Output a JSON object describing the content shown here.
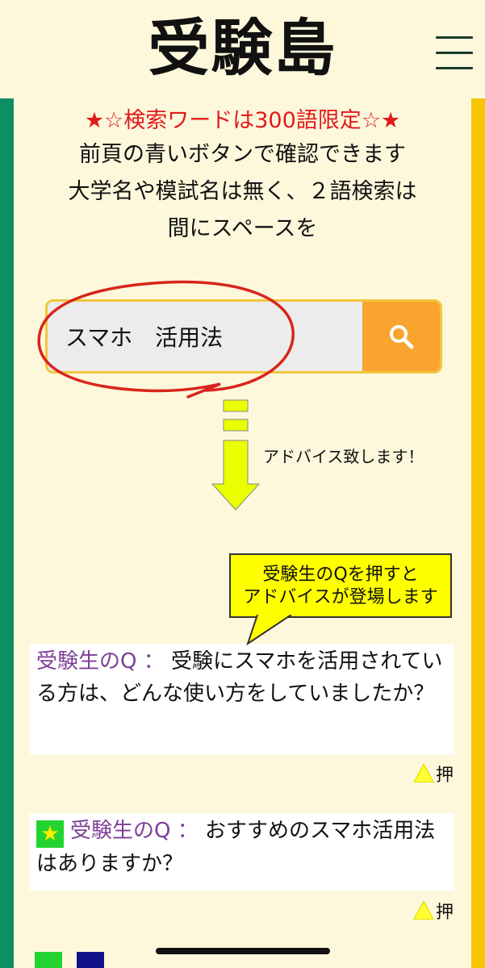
{
  "header": {
    "site_title": "受験島"
  },
  "notice": {
    "limit": "★☆検索ワードは300語限定☆★",
    "line1": "前頁の青いボタンで確認できます",
    "line2": "大学名や模試名は無く、２語検索は",
    "line3": "間にスペースを"
  },
  "search": {
    "value": "スマホ　活用法"
  },
  "advice_text": "アドバイス致します！",
  "bubble": {
    "line1": "受験生のQを押すと",
    "line2": "アドバイスが登場します"
  },
  "qa_items": [
    {
      "label": "受験生のQ ：",
      "text": " 受験にスマホを活用されている方は、どんな使い方をしていましたか？",
      "push_label": "押"
    },
    {
      "badge": "★",
      "label": "受験生のQ ：",
      "text": " おすすめのスマホ活用法はありますか？",
      "push_label": "押"
    }
  ],
  "colors": {
    "background": "#fdf8dc",
    "left_bar": "#0e8f63",
    "right_bar": "#f7c600",
    "search_button": "#f9a42f",
    "notice_red": "#e11a1a",
    "question_label": "#7d3f98",
    "bubble": "#ffff00",
    "arrow": "#eaff00"
  },
  "icons": {
    "menu": "hamburger-menu-icon",
    "search": "magnifier-icon",
    "push": "triangle-icon"
  }
}
